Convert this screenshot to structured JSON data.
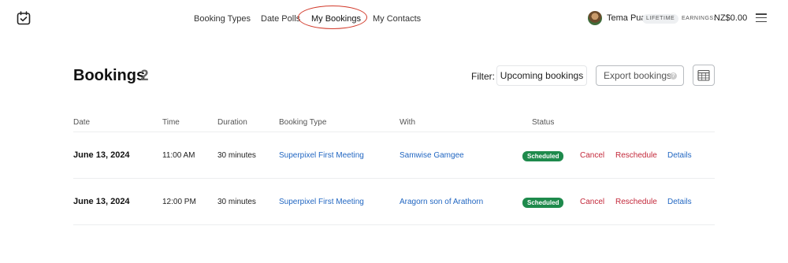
{
  "nav": {
    "items": [
      "Booking Types",
      "Date Polls",
      "My Bookings",
      "My Contacts"
    ],
    "active": "My Bookings"
  },
  "user": {
    "name": "Tema Pua",
    "badge": "LIFETIME",
    "earnings_label": "EARNINGS:",
    "earnings_value": "NZ$0.00"
  },
  "page": {
    "title": "Bookings",
    "count": "2"
  },
  "toolbar": {
    "filter_label": "Filter:",
    "filter_value": "Upcoming bookings",
    "export_label": "Export bookings",
    "help_glyph": "?"
  },
  "table": {
    "headers": [
      "Date",
      "Time",
      "Duration",
      "Booking Type",
      "With",
      "Status"
    ],
    "rows": [
      {
        "date": "June 13, 2024",
        "time": "11:00 AM",
        "duration": "30 minutes",
        "booking_type": "Superpixel First Meeting",
        "with": "Samwise Gamgee",
        "status": "Scheduled",
        "actions": [
          "Cancel",
          "Reschedule",
          "Details"
        ]
      },
      {
        "date": "June 13, 2024",
        "time": "12:00 PM",
        "duration": "30 minutes",
        "booking_type": "Superpixel First Meeting",
        "with": "Aragorn son of Arathorn",
        "status": "Scheduled",
        "actions": [
          "Cancel",
          "Reschedule",
          "Details"
        ]
      }
    ]
  },
  "colors": {
    "link": "#2267c2",
    "danger": "#c3283a",
    "status_scheduled": "#1e8a4c",
    "highlight_annotation": "#d23a2b"
  },
  "icons": [
    "calendar-check-logo-icon",
    "help-icon",
    "calendar-icon",
    "hamburger-menu-icon"
  ]
}
